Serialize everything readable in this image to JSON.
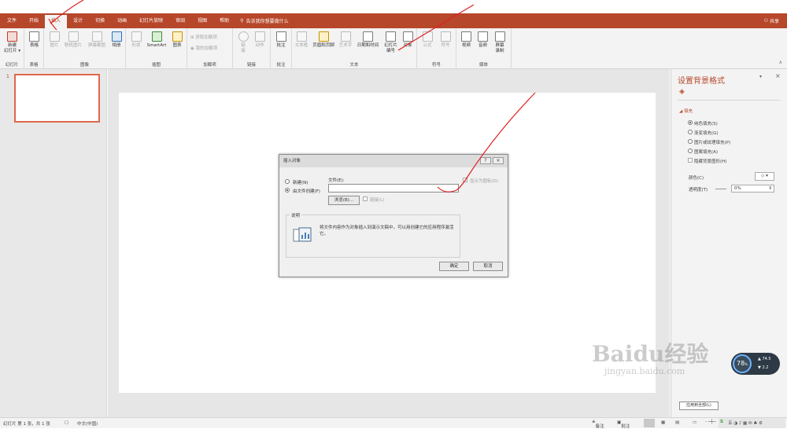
{
  "tabs": [
    "文件",
    "开始",
    "插入",
    "设计",
    "切换",
    "动画",
    "幻灯片放映",
    "审阅",
    "视图",
    "帮助"
  ],
  "tell_me": "告诉我你想要做什么",
  "share": "共享",
  "ribbon": {
    "new_slide": "新建\n幻灯片 ▾",
    "slides_group": "幻灯片",
    "table": "表格",
    "table_group": "表格",
    "picture": "图片",
    "online_picture": "联机图片",
    "screenshot": "屏幕截图",
    "album": "相册",
    "images_group": "图像",
    "shapes": "形状",
    "smartart": "SmartArt",
    "chart": "图表",
    "illustrations_group": "插图",
    "get_addins": "获取加载项",
    "my_addins": "我的加载项",
    "addins_group": "加载项",
    "link": "链\n接",
    "action": "动作",
    "links_group": "链接",
    "comment": "批注",
    "comments_group": "批注",
    "textbox": "文本框",
    "header_footer": "页眉和页脚",
    "wordart": "艺术字",
    "datetime": "日期和时间",
    "slide_number": "幻灯片\n编号",
    "object": "对象",
    "text_group": "文本",
    "equation": "公式",
    "symbol": "符号",
    "symbols_group": "符号",
    "video": "视频",
    "audio": "音频",
    "screen_recording": "屏幕\n录制",
    "media_group": "媒体"
  },
  "thumbnail_number": "1",
  "dialog": {
    "title": "插入对象",
    "help": "?",
    "close": "×",
    "create_new": "新建(N)",
    "create_from_file": "由文件创建(F)",
    "file_label": "文件(E):",
    "file_value": "",
    "browse": "浏览(B)...",
    "link": "链接(L)",
    "display_as_icon": "显示为图标(D)",
    "result_label": "说明",
    "result_text": "将文件内容作为对象插入到演示文稿中，可以用创建它的应用程序激活它。",
    "ok": "确定",
    "cancel": "取消"
  },
  "pane": {
    "title": "设置背景格式",
    "section": "填充",
    "options": [
      "纯色填充(S)",
      "渐变填充(G)",
      "图片或纹理填充(P)",
      "图案填充(A)"
    ],
    "hide_bg": "隐藏背景图形(H)",
    "color_label": "颜色(C)",
    "transparency_label": "透明度(T)",
    "transparency_value": "0%",
    "apply_all": "应用到全部(L)"
  },
  "status": {
    "slide_info": "幻灯片 第 1 张，共 1 张",
    "language": "中文(中国)",
    "notes": "备注",
    "comments": "批注"
  },
  "widget": {
    "percent": "78",
    "up": "74.5",
    "down": "2.2"
  },
  "watermark": {
    "line1": "Baidu经验",
    "line2": "jingyan.baidu.com"
  },
  "colors": {
    "accent": "#b7472a",
    "annotation": "#e02020"
  }
}
